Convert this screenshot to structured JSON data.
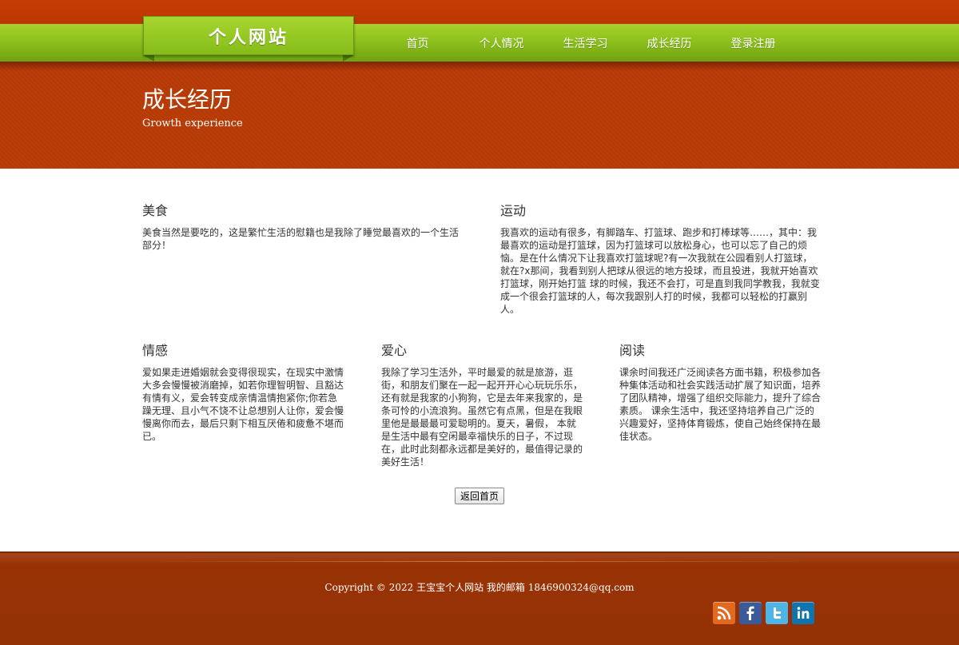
{
  "site": {
    "logo_text": "个人网站"
  },
  "nav": {
    "items": [
      {
        "label": "首页"
      },
      {
        "label": "个人情况"
      },
      {
        "label": "生活学习"
      },
      {
        "label": "成长经历"
      },
      {
        "label": "登录注册"
      }
    ]
  },
  "banner": {
    "title": "成长经历",
    "subtitle": "Growth experience"
  },
  "sections": {
    "food": {
      "title": "美食",
      "text": "美食当然是要吃的，这是繁忙生活的慰籍也是我除了睡觉最喜欢的一个生活部分！"
    },
    "sport": {
      "title": "运动",
      "text": "我喜欢的运动有很多，有脚踏车、打篮球、跑步和打棒球等……，其中：我最喜欢的运动是打篮球，因为打篮球可以放松身心，也可以忘了自己的烦恼。是在什么情况下让我喜欢打篮球呢?有一次我就在公园看别人打篮球，就在?x那间，我看到别人把球从很远的地方投球，而且投进，我就开始喜欢打篮球，刚开始打篮 球的时候，我还不会打，可是直到我同学教我，我就变成一个很会打篮球的人，每次我跟别人打的时候，我都可以轻松的打赢别人。"
    },
    "emotion": {
      "title": "情感",
      "text": "爱如果走进婚姻就会变得很现实，在现实中激情大多会慢慢被消磨掉，如若你理智明智、且豁达有情有义，爱会转变成亲情温情抱紧你;你若急躁无理、且小气不饶不让总想别人让你，爱会慢慢离你而去，最后只剩下相互厌倦和疲惫不堪而已。"
    },
    "love": {
      "title": "爱心",
      "text": "我除了学习生活外，平时最爱的就是旅游，逛街，和朋友们聚在一起一起开开心心玩玩乐乐， 还有就是我家的小狗狗，它是去年来我家的，是条可怜的小流浪狗。虽然它有点黑，但是在我眼里他是最最最可爱聪明的。夏天，暑假， 本就是生活中最有空闲最幸福快乐的日子，不过现在，此时此刻都永远都是美好的，最值得记录的美好生活！"
    },
    "reading": {
      "title": "阅读",
      "text": "课余时间我还广泛阅读各方面书籍，积极参加各种集体活动和社会实践活动扩展了知识面，培养了团队精神，增强了组织交际能力，提升了综合素质。 课余生活中，我还坚持培养自己广泛的兴趣爱好，坚持体育锻炼，使自己始终保持在最佳状态。"
    }
  },
  "back_button": {
    "label": "返回首页"
  },
  "footer": {
    "copyright": "Copyright © 2022 王宝宝个人网站 我的邮箱 1846900324@qq.com",
    "social": [
      {
        "icon": "rss-icon",
        "glyph": "RSS",
        "color": "#e2691f"
      },
      {
        "icon": "facebook-icon",
        "glyph": "f",
        "color": "#3b5a9a"
      },
      {
        "icon": "twitter-icon",
        "glyph": "t",
        "color": "#4fb5e6"
      },
      {
        "icon": "linkedin-icon",
        "glyph": "in",
        "color": "#0f75b0"
      }
    ]
  },
  "colors": {
    "header_orange": "#c63d04",
    "nav_green": "#8ec11d",
    "banner": "#ba3b05",
    "footer": "#973305"
  }
}
